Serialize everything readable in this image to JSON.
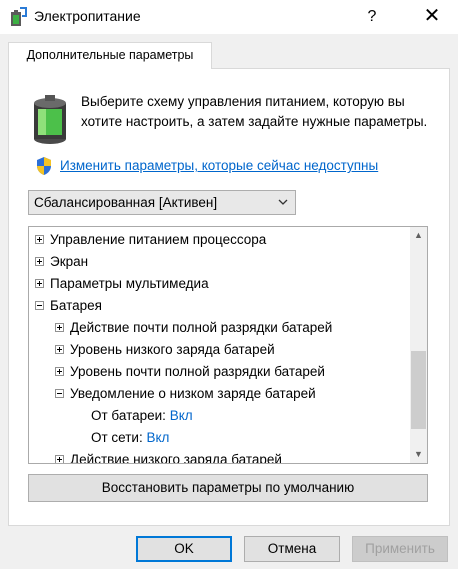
{
  "window": {
    "title": "Электропитание",
    "help_label": "?",
    "close_label": "✕"
  },
  "tab": {
    "label": "Дополнительные параметры"
  },
  "description": "Выберите схему управления питанием, которую вы хотите настроить, а затем задайте нужные параметры.",
  "change_settings_link": "Изменить параметры, которые сейчас недоступны",
  "scheme": {
    "selected": "Сбалансированная [Активен]"
  },
  "tree": {
    "items": [
      {
        "label": "Управление питанием процессора",
        "expander": "plus"
      },
      {
        "label": "Экран",
        "expander": "plus"
      },
      {
        "label": "Параметры мультимедиа",
        "expander": "plus"
      },
      {
        "label": "Батарея",
        "expander": "minus"
      },
      {
        "label": "Действие почти полной разрядки батарей",
        "expander": "plus"
      },
      {
        "label": "Уровень низкого заряда батарей",
        "expander": "plus"
      },
      {
        "label": "Уровень почти полной разрядки батарей",
        "expander": "plus"
      },
      {
        "label": "Уведомление о низком заряде батарей",
        "expander": "minus"
      },
      {
        "label": "От батареи:",
        "value": "Вкл"
      },
      {
        "label": "От сети:",
        "value": "Вкл"
      },
      {
        "label": "Действие низкого заряда батарей",
        "expander": "plus"
      }
    ]
  },
  "buttons": {
    "restore": "Восстановить параметры по умолчанию",
    "ok": "OK",
    "cancel": "Отмена",
    "apply": "Применить"
  },
  "icons": {
    "app": "power-options-icon",
    "battery": "battery-icon",
    "shield": "uac-shield-icon"
  },
  "colors": {
    "link": "#0066cc",
    "focus": "#0078d7"
  }
}
